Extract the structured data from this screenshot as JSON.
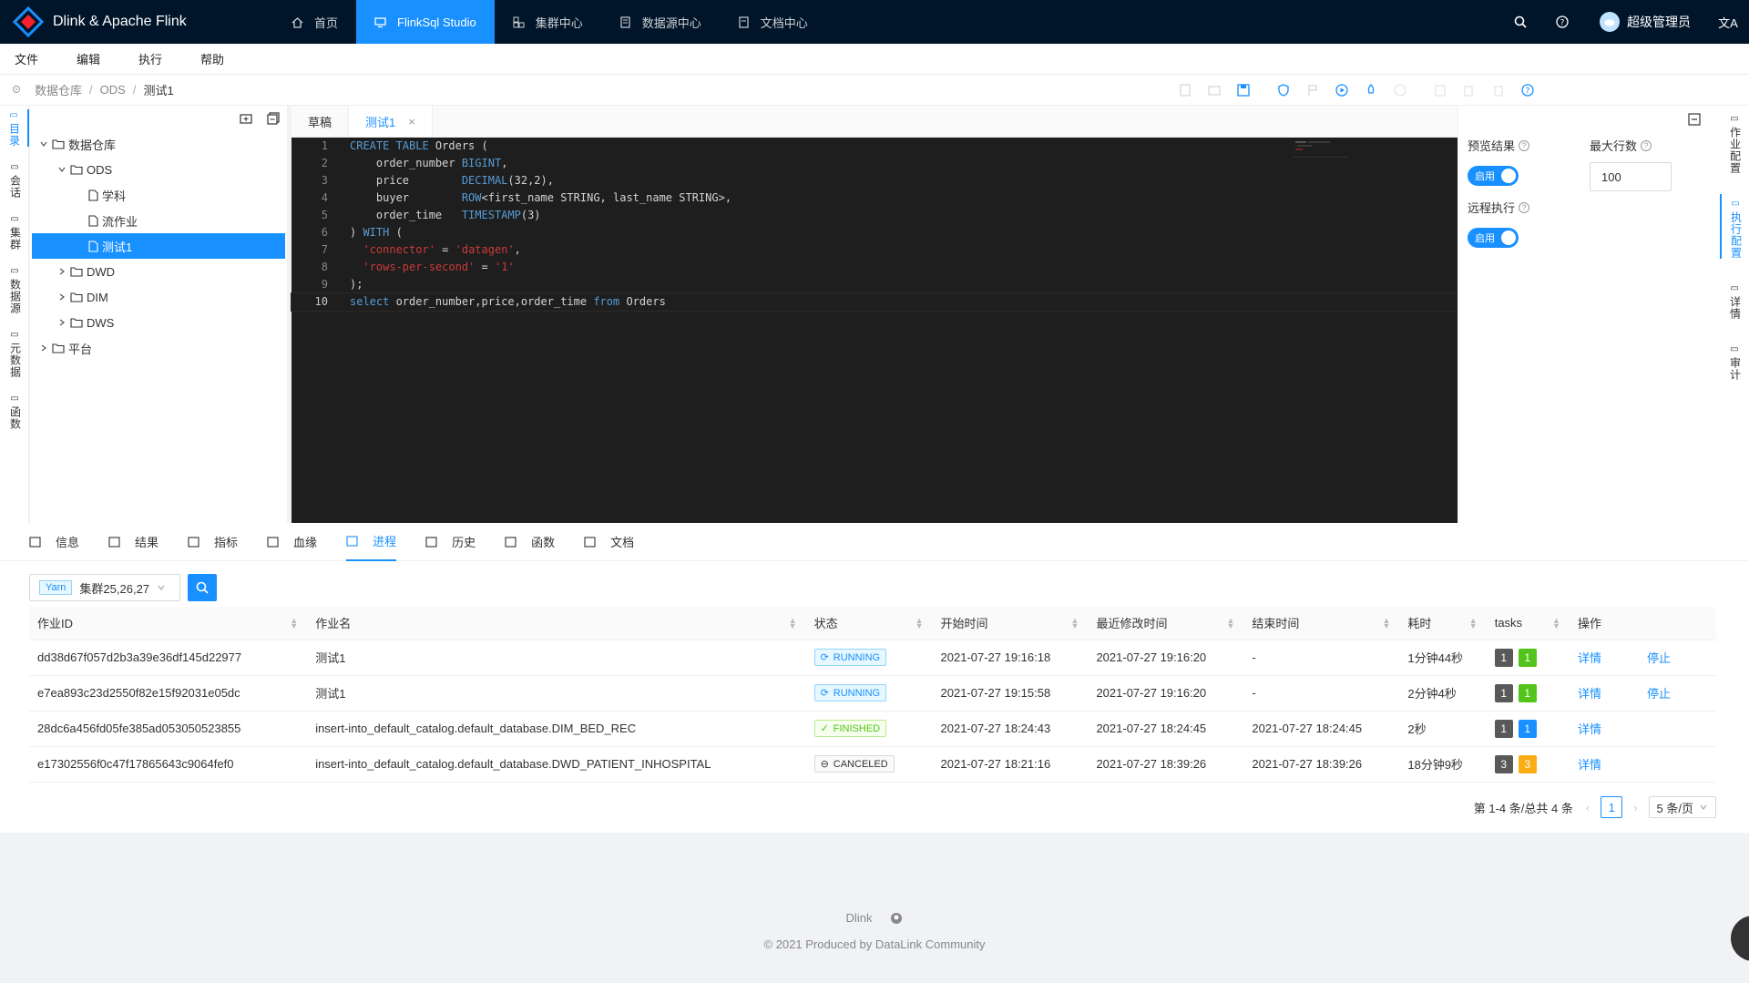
{
  "app": {
    "title": "Dlink & Apache Flink"
  },
  "nav": [
    {
      "label": "首页",
      "icon": "home-icon"
    },
    {
      "label": "FlinkSql Studio",
      "icon": "monitor-icon",
      "active": true
    },
    {
      "label": "集群中心",
      "icon": "cluster-icon"
    },
    {
      "label": "数据源中心",
      "icon": "database-icon"
    },
    {
      "label": "文档中心",
      "icon": "document-icon"
    }
  ],
  "user": {
    "name": "超级管理员"
  },
  "menu": [
    "文件",
    "编辑",
    "执行",
    "帮助"
  ],
  "breadcrumb": [
    "数据仓库",
    "ODS",
    "测试1"
  ],
  "left_rail": [
    {
      "label": "目录",
      "active": true
    },
    {
      "label": "会话"
    },
    {
      "label": "集群"
    },
    {
      "label": "数据源"
    },
    {
      "label": "元数据"
    },
    {
      "label": "函数"
    }
  ],
  "tree": [
    {
      "label": "数据仓库",
      "depth": 0,
      "type": "folder",
      "open": true
    },
    {
      "label": "ODS",
      "depth": 1,
      "type": "folder",
      "open": true
    },
    {
      "label": "学科",
      "depth": 2,
      "type": "file"
    },
    {
      "label": "流作业",
      "depth": 2,
      "type": "file"
    },
    {
      "label": "测试1",
      "depth": 2,
      "type": "file",
      "selected": true
    },
    {
      "label": "DWD",
      "depth": 1,
      "type": "folder"
    },
    {
      "label": "DIM",
      "depth": 1,
      "type": "folder"
    },
    {
      "label": "DWS",
      "depth": 1,
      "type": "folder"
    },
    {
      "label": "平台",
      "depth": 0,
      "type": "folder"
    }
  ],
  "editor_tabs": [
    {
      "label": "草稿"
    },
    {
      "label": "测试1",
      "active": true,
      "closable": "×"
    }
  ],
  "code_lines": [
    [
      [
        "kw",
        "CREATE TABLE"
      ],
      [
        "",
        " Orders ("
      ]
    ],
    [
      [
        "",
        "    order_number "
      ],
      [
        "kw",
        "BIGINT"
      ],
      [
        "",
        ","
      ]
    ],
    [
      [
        "",
        "    price        "
      ],
      [
        "kw",
        "DECIMAL"
      ],
      [
        "",
        "(32,2),"
      ]
    ],
    [
      [
        "",
        "    buyer        "
      ],
      [
        "kw",
        "ROW"
      ],
      [
        "",
        "<first_name STRING, last_name STRING>,"
      ]
    ],
    [
      [
        "",
        "    order_time   "
      ],
      [
        "kw",
        "TIMESTAMP"
      ],
      [
        "",
        "(3)"
      ]
    ],
    [
      [
        "",
        ") "
      ],
      [
        "kw",
        "WITH"
      ],
      [
        "",
        " ("
      ]
    ],
    [
      [
        "",
        "  "
      ],
      [
        "str",
        "'connector'"
      ],
      [
        "",
        " = "
      ],
      [
        "str",
        "'datagen'"
      ],
      [
        "",
        ","
      ]
    ],
    [
      [
        "",
        "  "
      ],
      [
        "str",
        "'rows-per-second'"
      ],
      [
        "",
        " = "
      ],
      [
        "str",
        "'1'"
      ]
    ],
    [
      [
        "",
        ");"
      ]
    ],
    [
      [
        "kw",
        "select"
      ],
      [
        "",
        " order_number,price,order_time "
      ],
      [
        "kw",
        "from"
      ],
      [
        "",
        " Orders"
      ]
    ]
  ],
  "config": {
    "preview_label": "预览结果",
    "preview_switch": "启用",
    "max_rows_label": "最大行数",
    "max_rows_value": "100",
    "remote_label": "远程执行",
    "remote_switch": "启用"
  },
  "right_rail": [
    {
      "label": "作业配置"
    },
    {
      "label": "执行配置",
      "active": true
    },
    {
      "label": "详情"
    },
    {
      "label": "审计"
    }
  ],
  "bottom_tabs": [
    {
      "label": "信息"
    },
    {
      "label": "结果"
    },
    {
      "label": "指标"
    },
    {
      "label": "血缘"
    },
    {
      "label": "进程",
      "active": true
    },
    {
      "label": "历史"
    },
    {
      "label": "函数"
    },
    {
      "label": "文档"
    }
  ],
  "filter": {
    "tag": "Yarn",
    "cluster": "集群25,26,27"
  },
  "table": {
    "headers": [
      "作业ID",
      "作业名",
      "状态",
      "开始时间",
      "最近修改时间",
      "结束时间",
      "耗时",
      "tasks",
      "操作"
    ],
    "rows": [
      {
        "id": "dd38d67f057d2b3a39e36df145d22977",
        "name": "测试1",
        "status": "RUNNING",
        "start": "2021-07-27 19:16:18",
        "modified": "2021-07-27 19:16:20",
        "end": "-",
        "duration": "1分钟44秒",
        "tasks": [
          "1",
          "1"
        ],
        "task_colors": [
          "#595959",
          "#52c41a"
        ],
        "actions": [
          "详情",
          "停止"
        ]
      },
      {
        "id": "e7ea893c23d2550f82e15f92031e05dc",
        "name": "测试1",
        "status": "RUNNING",
        "start": "2021-07-27 19:15:58",
        "modified": "2021-07-27 19:16:20",
        "end": "-",
        "duration": "2分钟4秒",
        "tasks": [
          "1",
          "1"
        ],
        "task_colors": [
          "#595959",
          "#52c41a"
        ],
        "actions": [
          "详情",
          "停止"
        ]
      },
      {
        "id": "28dc6a456fd05fe385ad053050523855",
        "name": "insert-into_default_catalog.default_database.DIM_BED_REC",
        "status": "FINISHED",
        "start": "2021-07-27 18:24:43",
        "modified": "2021-07-27 18:24:45",
        "end": "2021-07-27 18:24:45",
        "duration": "2秒",
        "tasks": [
          "1",
          "1"
        ],
        "task_colors": [
          "#595959",
          "#1890ff"
        ],
        "actions": [
          "详情"
        ]
      },
      {
        "id": "e17302556f0c47f17865643c9064fef0",
        "name": "insert-into_default_catalog.default_database.DWD_PATIENT_INHOSPITAL",
        "status": "CANCELED",
        "start": "2021-07-27 18:21:16",
        "modified": "2021-07-27 18:39:26",
        "end": "2021-07-27 18:39:26",
        "duration": "18分钟9秒",
        "tasks": [
          "3",
          "3"
        ],
        "task_colors": [
          "#595959",
          "#faad14"
        ],
        "actions": [
          "详情"
        ]
      }
    ]
  },
  "pagination": {
    "summary": "第 1-4 条/总共 4 条",
    "page": "1",
    "page_size": "5 条/页"
  },
  "footer": {
    "brand": "Dlink",
    "copyright": "2021 Produced by DataLink Community"
  }
}
